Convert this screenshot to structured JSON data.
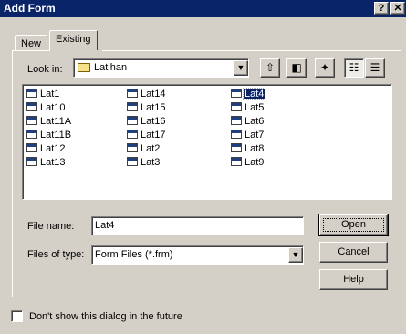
{
  "window": {
    "title": "Add Form",
    "help_glyph": "?",
    "close_glyph": "✕"
  },
  "tabs": [
    {
      "label": "New",
      "active": false
    },
    {
      "label": "Existing",
      "active": true
    }
  ],
  "lookin": {
    "label": "Look in:",
    "value": "Latihan",
    "toolbar_icons": [
      "up-one-level-icon",
      "desktop-icon",
      "new-folder-icon",
      "list-view-icon",
      "details-view-icon"
    ]
  },
  "files": {
    "columns": [
      [
        "Lat1",
        "Lat10",
        "Lat11A",
        "Lat11B",
        "Lat12",
        "Lat13"
      ],
      [
        "Lat14",
        "Lat15",
        "Lat16",
        "Lat17",
        "Lat2",
        "Lat3"
      ],
      [
        "Lat4",
        "Lat5",
        "Lat6",
        "Lat7",
        "Lat8",
        "Lat9"
      ]
    ],
    "selected": "Lat4"
  },
  "filename": {
    "label": "File name:",
    "value": "Lat4"
  },
  "filetype": {
    "label": "Files of type:",
    "value": "Form Files (*.frm)"
  },
  "buttons": {
    "open": "Open",
    "cancel": "Cancel",
    "help": "Help"
  },
  "footer": {
    "dont_show_label": "Don't show this dialog in the future",
    "checked": false
  },
  "colors": {
    "face": "#d4d0c8",
    "titlebar": "#0a246a",
    "selection": "#0a246a"
  }
}
